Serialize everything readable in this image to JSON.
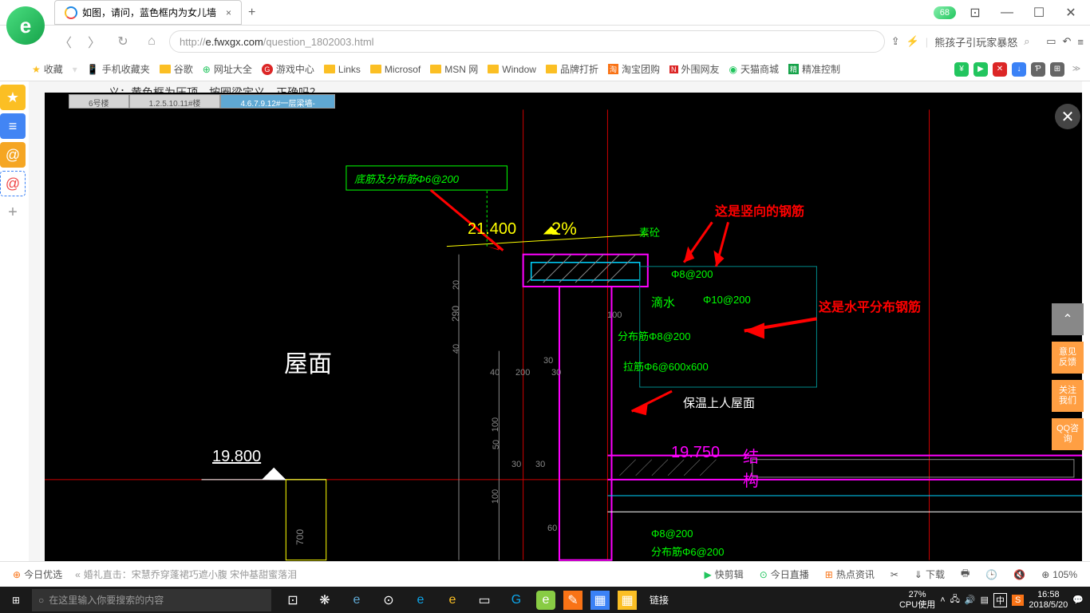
{
  "titlebar": {
    "tab_title": "如图，请问，蓝色框内为女儿墙",
    "badge": "68"
  },
  "addressbar": {
    "protocol": "http://",
    "domain": "e.fwxgx.com",
    "path": "/question_1802003.html",
    "right_text": "熊孩子引玩家暴怒"
  },
  "bookmarks": {
    "fav": "收藏",
    "items": [
      "手机收藏夹",
      "谷歌",
      "网址大全",
      "游戏中心",
      "Links",
      "Microsof",
      "MSN 网",
      "Window",
      "品牌打折",
      "淘宝团购",
      "外围网友",
      "天猫商城",
      "精准控制"
    ]
  },
  "page": {
    "text_fragment": "义；黄色框为压顶，按圈梁定义，正确吗？"
  },
  "cad": {
    "tabs": [
      "6号楼",
      "1.2.5.10.11#楼",
      "4.6.7.9.12#一层梁墙-"
    ],
    "annotations": {
      "box_label": "底筋及分布筋Φ6@200",
      "elevation_top": "21.400",
      "slope": "2%",
      "concrete": "素砼",
      "red1": "这是竖向的钢筋",
      "red2": "这是水平分布钢筋",
      "rebar1": "Φ8@200",
      "drip": "滴水",
      "rebar2": "Φ10@200",
      "dist_rebar": "分布筋Φ8@200",
      "tie_rebar": "拉筋Φ6@600x600",
      "roof_label": "保温上人屋面",
      "room_label": "屋面",
      "elevation_left": "19.800",
      "elevation_right": "19.750",
      "struct_label": "结构",
      "rebar3": "Φ8@200",
      "dist_rebar2": "分布筋Φ6@200"
    },
    "dimensions": {
      "d20": "20",
      "d290": "290",
      "d40a": "40",
      "d40b": "40",
      "d200": "200",
      "d30a": "30",
      "d30b": "30",
      "d100a": "100",
      "d50": "50",
      "d100b": "100",
      "d30c": "30",
      "d30d": "30",
      "d100c": "100",
      "d60": "60",
      "d700": "700"
    }
  },
  "right_sidebar": {
    "btn1": "意见反馈",
    "btn2": "关注我们",
    "btn3": "QQ咨询"
  },
  "infobar": {
    "today": "今日优选",
    "news": "婚礼直击：宋慧乔穿蓬裙巧遮小腹 宋仲基甜蜜落泪",
    "items": [
      "快剪辑",
      "今日直播",
      "热点资讯",
      "",
      "下载",
      "",
      "",
      ""
    ],
    "zoom": "105%"
  },
  "taskbar": {
    "search_placeholder": "在这里输入你要搜索的内容",
    "link": "链接",
    "cpu_pct": "27%",
    "cpu_label": "CPU使用",
    "ime": "中",
    "time": "16:58",
    "date": "2018/5/20"
  }
}
